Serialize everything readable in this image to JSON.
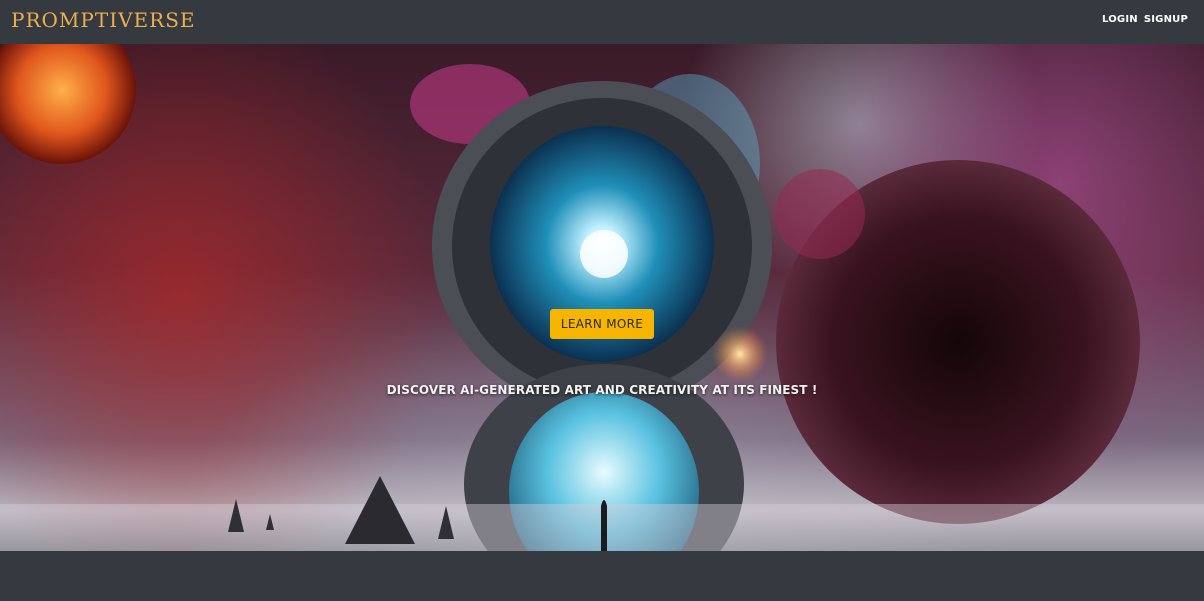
{
  "navbar": {
    "brand": "PROMPTIVERSE",
    "links": {
      "login": "LOGIN",
      "signup": "SIGNUP"
    }
  },
  "hero": {
    "cta_label": "LEARN MORE",
    "tagline": "DISCOVER AI-GENERATED ART AND CREATIVITY AT ITS FINEST !"
  },
  "colors": {
    "navbar_bg": "#343a40",
    "brand": "#f0ad4e",
    "cta_bg": "#f7b500",
    "footer_bg": "#343a40"
  }
}
